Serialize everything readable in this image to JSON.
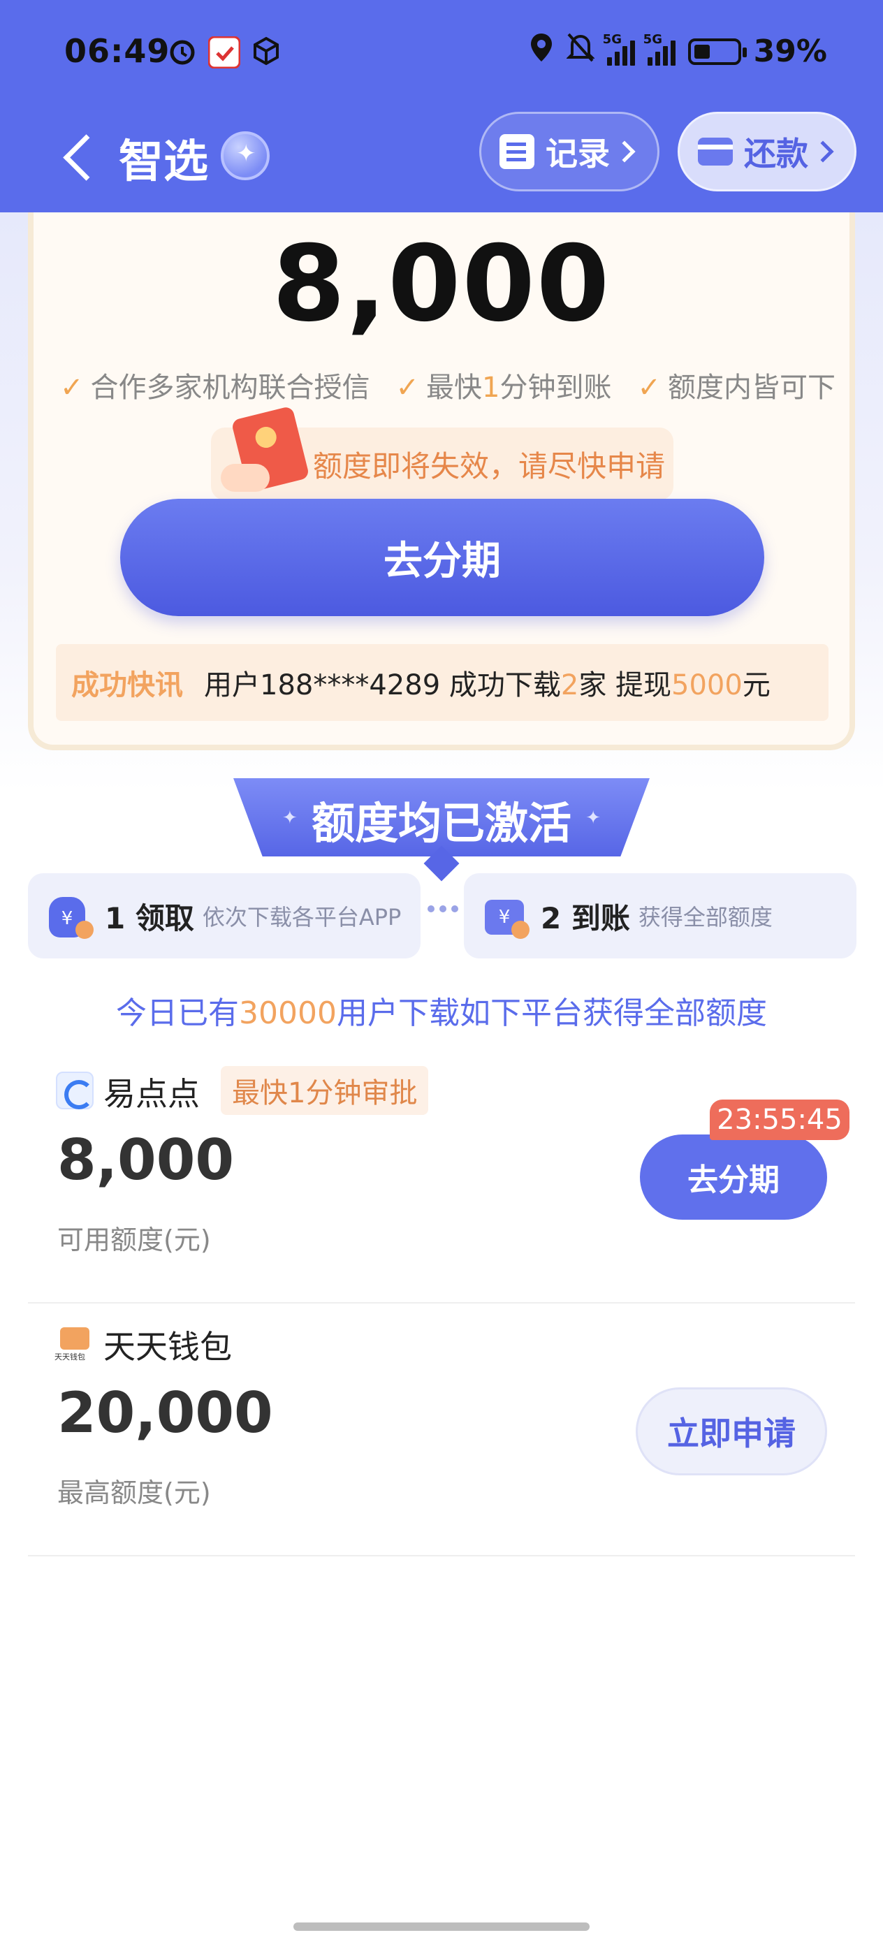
{
  "status_bar": {
    "time": "06:49",
    "battery": "39%",
    "network": "5G"
  },
  "nav": {
    "title": "智选",
    "record_label": "记录",
    "repay_label": "还款"
  },
  "hero": {
    "amount": "8,000",
    "features": [
      {
        "pre": "合作多家机构联合授信",
        "em": "",
        "post": ""
      },
      {
        "pre": "最快",
        "em": "1",
        "post": "分钟到账"
      },
      {
        "pre": "额度内皆可下",
        "em": "",
        "post": ""
      }
    ],
    "expire_notice": "额度即将失效，请尽快申请",
    "cta_label": "去分期"
  },
  "news": {
    "tag": "成功快讯",
    "text_pre": "用户188****4289 成功下载",
    "count": "2",
    "text_mid": "家 提现",
    "amount": "5000",
    "text_post": "元"
  },
  "activation": {
    "title": "额度均已激活",
    "steps": [
      {
        "num": "1 领取",
        "sub": "依次下载各平台APP",
        "icon": "money-bag-icon"
      },
      {
        "num": "2 到账",
        "sub": "获得全部额度",
        "icon": "wallet-icon"
      }
    ]
  },
  "today": {
    "pre": "今日已有",
    "count": "30000",
    "post": "用户下载如下平台获得全部额度"
  },
  "products": [
    {
      "name": "易点点",
      "tag": "最快1分钟审批",
      "amount": "8,000",
      "amount_label": "可用额度(元)",
      "button": "去分期",
      "countdown": "23:55:45"
    },
    {
      "name": "天天钱包",
      "amount": "20,000",
      "amount_label": "最高额度(元)",
      "button": "立即申请"
    }
  ],
  "colors": {
    "brand_blue": "#5a6ceb",
    "accent_orange": "#f2a35f",
    "countdown_red": "#ee6d5b"
  }
}
